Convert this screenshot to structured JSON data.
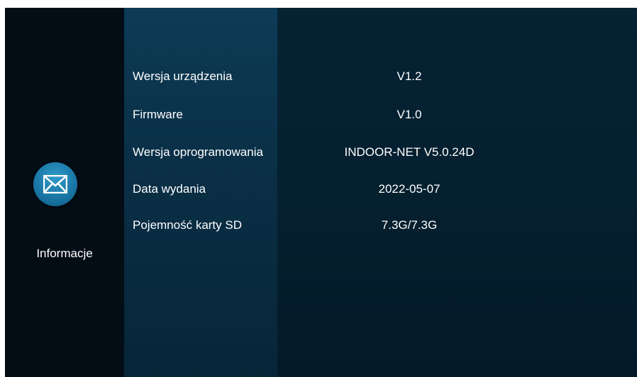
{
  "sidebar": {
    "icon": "envelope-icon",
    "label": "Informacje"
  },
  "info_rows": [
    {
      "label": "Wersja urządzenia",
      "value": "V1.2"
    },
    {
      "label": "Firmware",
      "value": "V1.0"
    },
    {
      "label": "Wersja oprogramowania",
      "value": "INDOOR-NET V5.0.24D"
    },
    {
      "label": "Data wydania",
      "value": "2022-05-07"
    },
    {
      "label": "Pojemność karty SD",
      "value": "7.3G/7.3G"
    }
  ],
  "colors": {
    "accent": "#1a77a6",
    "background": "#04111c",
    "label_panel": "#0d3b56",
    "text": "#ffffff"
  }
}
